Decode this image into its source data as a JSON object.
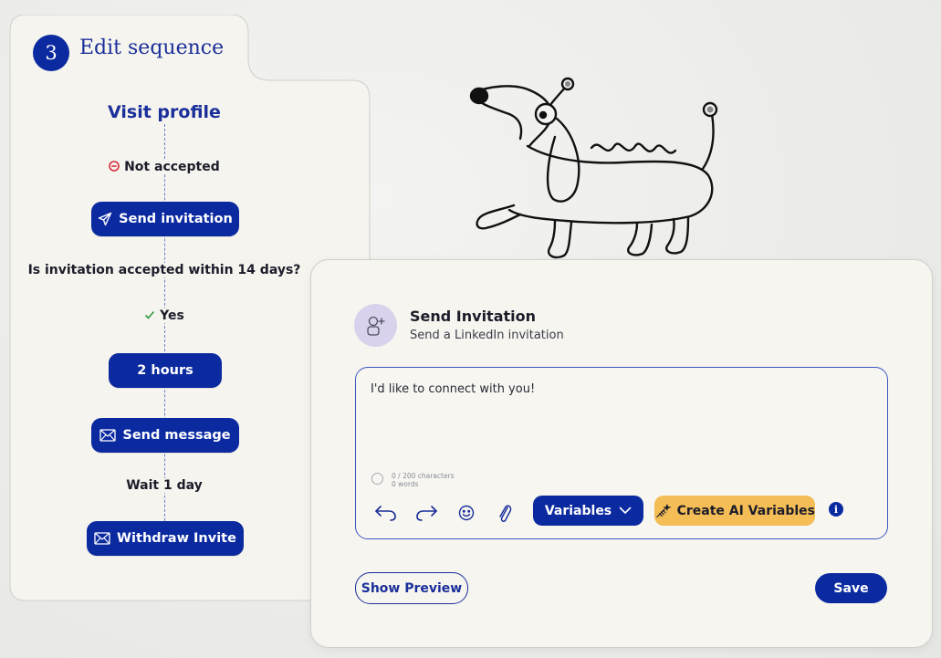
{
  "sequence": {
    "step_number": "3",
    "title": "Edit sequence",
    "steps": {
      "visit": "Visit profile",
      "not_accepted": "Not accepted",
      "send_invitation": "Send invitation",
      "question": "Is invitation accepted within 14 days?",
      "yes": "Yes",
      "delay": "2 hours",
      "send_message": "Send message",
      "wait": "Wait 1 day",
      "withdraw": "Withdraw Invite"
    }
  },
  "card": {
    "title": "Send Invitation",
    "subtitle": "Send a LinkedIn invitation",
    "message": "I'd like to connect with you!",
    "counter_chars": "0 / 200 characters",
    "counter_words": "0 words",
    "variables_label": "Variables",
    "ai_label": "Create AI Variables",
    "info_label": "i",
    "preview_label": "Show Preview",
    "save_label": "Save"
  },
  "colors": {
    "primary": "#0b2aa0",
    "accent_yellow": "#f4bd55",
    "panel_bg": "#f5f4ee",
    "negative": "#d62d3a",
    "positive": "#2f9a43"
  },
  "icons": {
    "not_accepted": "minus-circle-icon",
    "send": "paper-plane-icon",
    "yes": "check-icon",
    "mail": "envelope-icon",
    "undo": "undo-icon",
    "redo": "redo-icon",
    "emoji": "smiley-icon",
    "attach": "paperclip-icon",
    "chevron": "chevron-down-icon",
    "ai": "sparkle-wand-icon",
    "info": "info-icon",
    "avatar": "add-person-icon"
  }
}
